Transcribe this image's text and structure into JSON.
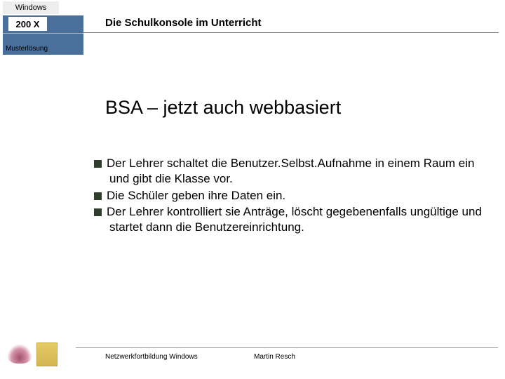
{
  "header": {
    "windows": "Windows",
    "version": "200 X",
    "title": "Die Schulkonsole im Unterricht",
    "subtitle": "Musterlösung"
  },
  "slide": {
    "title": "BSA – jetzt auch webbasiert",
    "bullets": [
      "Der Lehrer schaltet die Benutzer.Selbst.Aufnahme in einem Raum ein und gibt die Klasse vor.",
      "Die Schüler geben ihre Daten ein.",
      "Der Lehrer kontrolliert sie Anträge, löscht gegebenenfalls ungültige und startet dann die Benutzereinrichtung."
    ]
  },
  "footer": {
    "left": "Netzwerkfortbildung Windows",
    "right": "Martin Resch"
  }
}
